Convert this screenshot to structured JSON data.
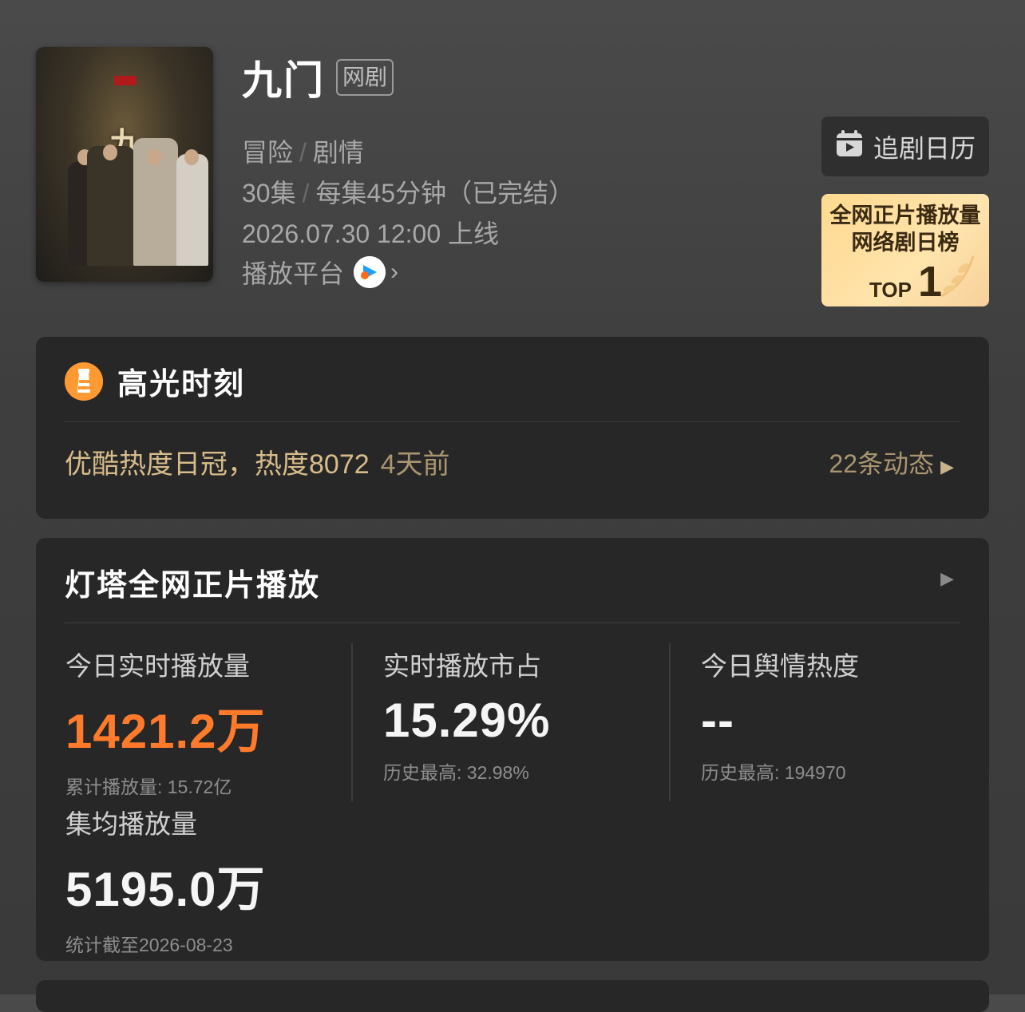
{
  "show": {
    "title": "九门",
    "tag": "网剧",
    "genre1": "冒险",
    "genre2": "剧情",
    "episodes": "30集",
    "duration": "每集45分钟（已完结）",
    "release": "2026.07.30 12:00 上线",
    "platform_label": "播放平台"
  },
  "calendar_button": {
    "label": "追剧日历",
    "icon": "calendar-icon"
  },
  "rank_badge": {
    "line1": "全网正片播放量",
    "line2": "网络剧日榜",
    "top_label": "TOP",
    "top_number": "1"
  },
  "highlight": {
    "title": "高光时刻",
    "text": "优酷热度日冠，热度8072",
    "time": "4天前",
    "more": "22条动态"
  },
  "playback": {
    "title": "灯塔全网正片播放",
    "stats": [
      {
        "label": "今日实时播放量",
        "value": "1421.2万",
        "sub": "累计播放量: 15.72亿"
      },
      {
        "label": "实时播放市占",
        "value": "15.29%",
        "sub": "历史最高: 32.98%"
      },
      {
        "label": "今日舆情热度",
        "value": "--",
        "sub": "历史最高: 194970"
      },
      {
        "label": "集均播放量",
        "value": "5195.0万",
        "sub": "统计截至2026-08-23"
      }
    ]
  },
  "colors": {
    "accent_orange": "#ff7a2a",
    "gold_text": "#d7bc8a",
    "card_bg": "#272727"
  }
}
